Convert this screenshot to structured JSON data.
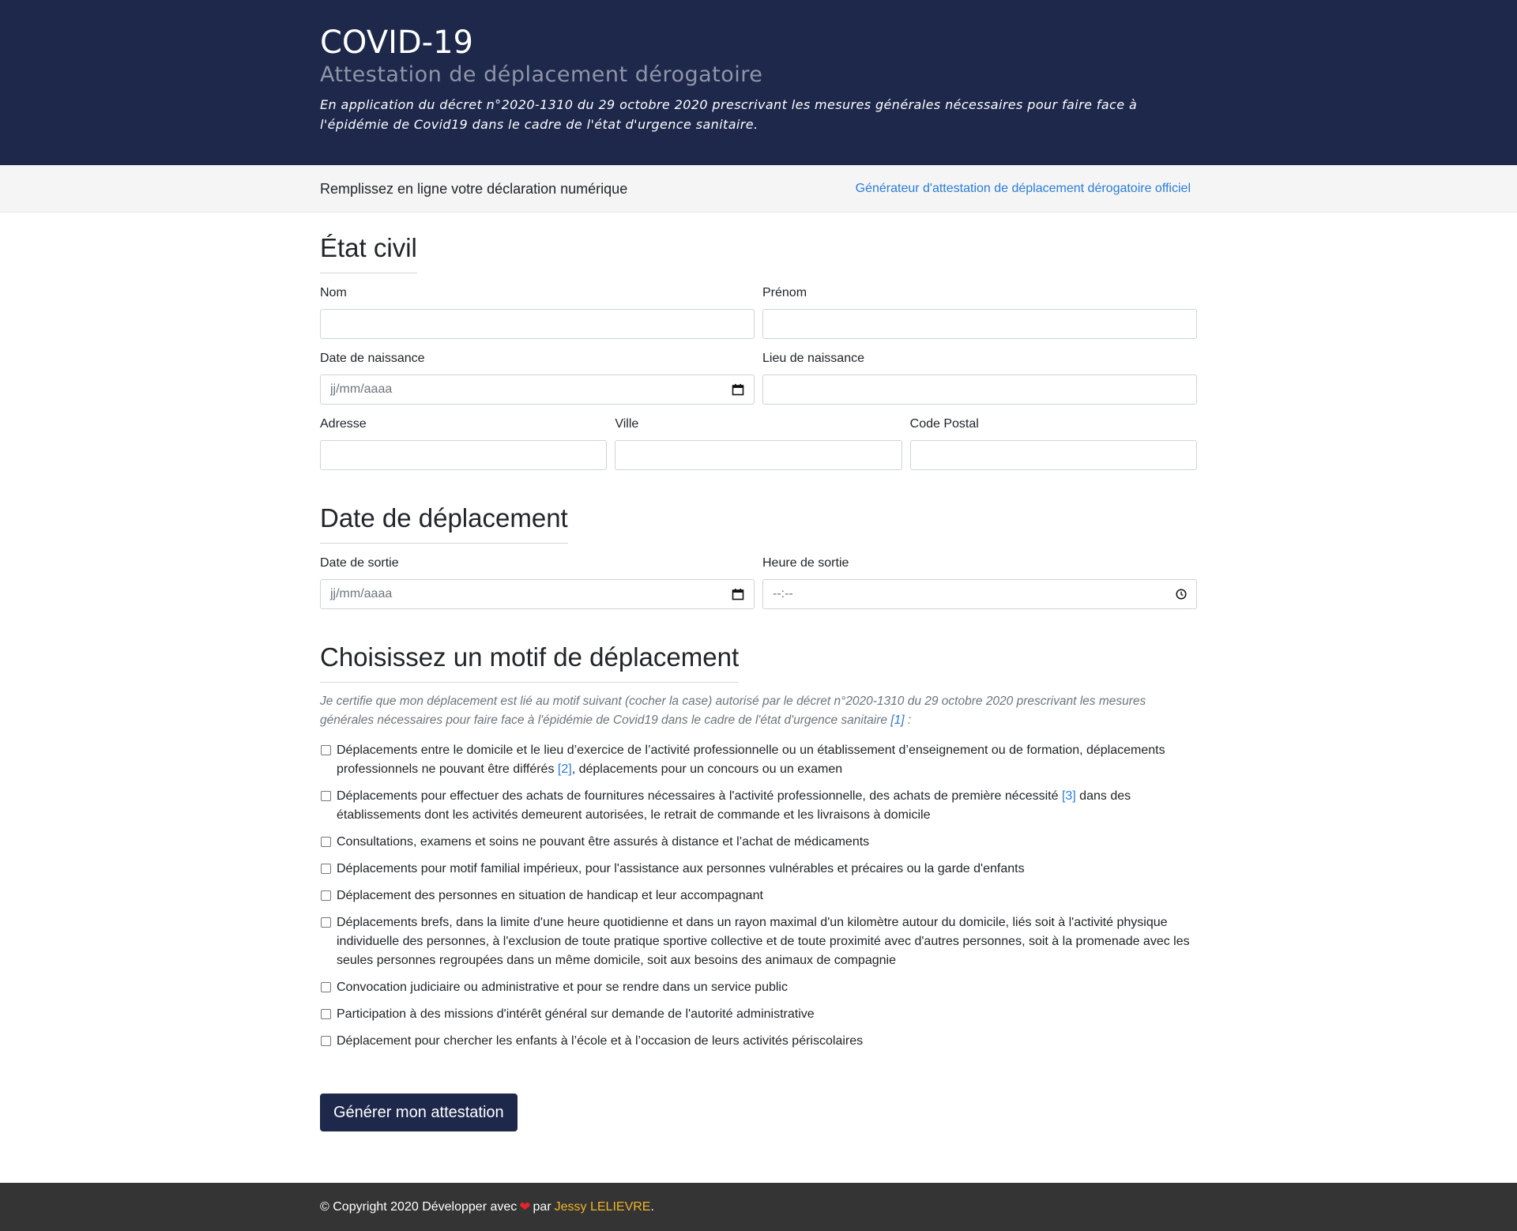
{
  "header": {
    "title": "COVID-19",
    "subtitle": "Attestation de déplacement dérogatoire",
    "intro": "En application du décret n°2020-1310 du 29 octobre 2020 prescrivant les mesures générales nécessaires pour faire face à l'épidémie de Covid19 dans le cadre de l'état d'urgence sanitaire."
  },
  "subnav": {
    "lead": "Remplissez en ligne votre déclaration numérique",
    "link": "Générateur d'attestation de déplacement dérogatoire officiel"
  },
  "etat_civil": {
    "title": "État civil",
    "nom_label": "Nom",
    "prenom_label": "Prénom",
    "date_naissance_label": "Date de naissance",
    "date_naissance_placeholder": "jj/mm/aaaa",
    "lieu_naissance_label": "Lieu de naissance",
    "adresse_label": "Adresse",
    "ville_label": "Ville",
    "code_postal_label": "Code Postal"
  },
  "deplacement": {
    "title": "Date de déplacement",
    "date_sortie_label": "Date de sortie",
    "date_sortie_placeholder": "jj/mm/aaaa",
    "heure_sortie_label": "Heure de sortie",
    "heure_sortie_placeholder": "--:--"
  },
  "motif": {
    "title": "Choisissez un motif de déplacement",
    "disclaimer": "Je certifie que mon déplacement est lié au motif suivant (cocher la case) autorisé par le décret n°2020-1310 du 29 octobre 2020 prescrivant les mesures générales nécessaires pour faire face à l'épidémie de Covid19 dans le cadre de l'état d'urgence sanitaire",
    "disclaimer_ref": "[1]",
    "disclaimer_end": " :",
    "items": [
      {
        "a": "Déplacements entre le domicile et le lieu d’exercice de l’activité professionnelle ou un établissement d’enseignement ou de formation, déplacements professionnels ne pouvant être différés ",
        "ref": "[2]",
        "b": ", déplacements pour un concours ou un examen"
      },
      {
        "a": "Déplacements pour effectuer des achats de fournitures nécessaires à l'activité professionnelle, des achats de première nécessité ",
        "ref": "[3]",
        "b": " dans des établissements dont les activités demeurent autorisées, le retrait de commande et les livraisons à domicile"
      },
      {
        "a": "Consultations, examens et soins ne pouvant être assurés à distance et l’achat de médicaments"
      },
      {
        "a": "Déplacements pour motif familial impérieux, pour l'assistance aux personnes vulnérables et précaires ou la garde d'enfants"
      },
      {
        "a": "Déplacement des personnes en situation de handicap et leur accompagnant"
      },
      {
        "a": "Déplacements brefs, dans la limite d'une heure quotidienne et dans un rayon maximal d'un kilomètre autour du domicile, liés soit à l'activité physique individuelle des personnes, à l'exclusion de toute pratique sportive collective et de toute proximité avec d'autres personnes, soit à la promenade avec les seules personnes regroupées dans un même domicile, soit aux besoins des animaux de compagnie"
      },
      {
        "a": "Convocation judiciaire ou administrative et pour se rendre dans un service public"
      },
      {
        "a": "Participation à des missions d'intérêt général sur demande de l'autorité administrative"
      },
      {
        "a": "Déplacement pour chercher les enfants à l’école et à l’occasion de leurs activités périscolaires"
      }
    ]
  },
  "submit_label": "Générer mon attestation",
  "footer": {
    "copyright": "© Copyright 2020 Développer avec",
    "heart": "❤",
    "par": " par",
    "author": "Jessy LELIEVRE",
    "end": "."
  },
  "colors": {
    "header_bg": "#1d284b",
    "link": "#2a7bdc",
    "footer_bg": "#343434",
    "author": "#f0b429",
    "heart": "#e0262a"
  }
}
